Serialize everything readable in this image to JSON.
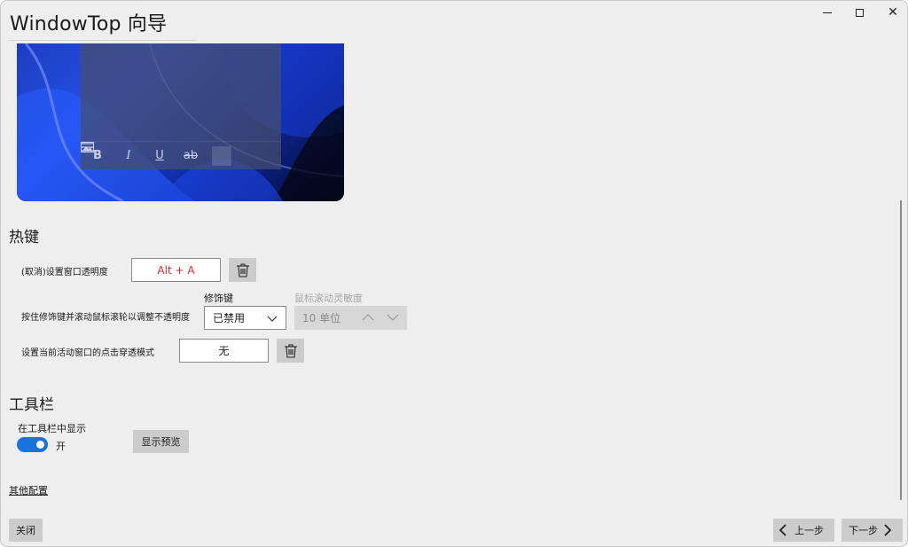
{
  "window": {
    "title": "WindowTop 向导"
  },
  "preview": {
    "toolbar_icons": [
      "bold-icon",
      "italic-icon",
      "underline-icon",
      "strikethrough-icon",
      "list-icon",
      "image-icon"
    ],
    "toolbar_labels": [
      "B",
      "I",
      "U",
      "ab",
      "",
      ""
    ]
  },
  "hotkeys": {
    "section_title": "热键",
    "row1_label": "(取消)设置窗口透明度",
    "row1_value": "Alt + A",
    "row2_label": "按住修饰键并滚动鼠标滚轮以调整不透明度",
    "modifier_header": "修饰键",
    "modifier_value": "已禁用",
    "sensitivity_header": "鼠标滚动灵敏度",
    "sensitivity_value": "10 单位",
    "row3_label": "设置当前活动窗口的点击穿透模式",
    "row3_value": "无"
  },
  "toolbar": {
    "section_title": "工具栏",
    "show_label": "在工具栏中显示",
    "toggle_state": "开",
    "toggle_on": true,
    "preview_button": "显示预览"
  },
  "other_config_link": "其他配置",
  "footer": {
    "close_button": "关闭",
    "prev_button": "上一步",
    "next_button": "下一步"
  },
  "colors": {
    "accent": "#1a73d9",
    "hotkey_text": "#d62b2b"
  }
}
